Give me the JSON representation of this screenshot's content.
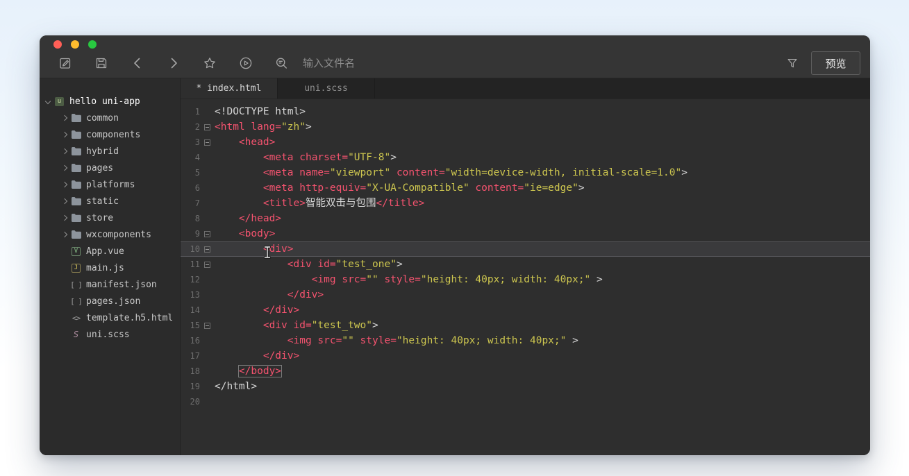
{
  "window": {
    "controls": [
      {
        "name": "close",
        "color": "#ff5f57"
      },
      {
        "name": "minimize",
        "color": "#febc2e"
      },
      {
        "name": "zoom",
        "color": "#28c840"
      }
    ]
  },
  "toolbar": {
    "icons": [
      "new-file",
      "save",
      "back",
      "forward",
      "star",
      "run",
      "find-file"
    ],
    "search": {
      "placeholder": "输入文件名",
      "value": ""
    },
    "right_icons": [
      "filter"
    ],
    "preview_label": "预览"
  },
  "sidebar": {
    "root": "hello uni-app",
    "folders": [
      "common",
      "components",
      "hybrid",
      "pages",
      "platforms",
      "static",
      "store",
      "wxcomponents"
    ],
    "files": [
      {
        "name": "App.vue",
        "icon": "vue-file"
      },
      {
        "name": "main.js",
        "icon": "js-file"
      },
      {
        "name": "manifest.json",
        "icon": "json-file"
      },
      {
        "name": "pages.json",
        "icon": "json-file"
      },
      {
        "name": "template.h5.html",
        "icon": "html-file"
      },
      {
        "name": "uni.scss",
        "icon": "scss-file"
      }
    ]
  },
  "tabs": [
    {
      "label": "* index.html",
      "active": true,
      "modified": true
    },
    {
      "label": "uni.scss",
      "active": false,
      "modified": false
    }
  ],
  "editor": {
    "language": "html",
    "current_line": 10,
    "lines": [
      {
        "n": 1,
        "fold": false,
        "toks": [
          [
            "p",
            "<!DOCTYPE html>"
          ]
        ]
      },
      {
        "n": 2,
        "fold": true,
        "toks": [
          [
            "t",
            "<html"
          ],
          [
            "p",
            " "
          ],
          [
            "t",
            "lang="
          ],
          [
            "s",
            "\"zh\""
          ],
          [
            "p",
            ">"
          ]
        ]
      },
      {
        "n": 3,
        "fold": true,
        "toks": [
          [
            "p",
            "    "
          ],
          [
            "t",
            "<head>"
          ]
        ]
      },
      {
        "n": 4,
        "fold": false,
        "toks": [
          [
            "p",
            "        "
          ],
          [
            "t",
            "<meta"
          ],
          [
            "p",
            " "
          ],
          [
            "t",
            "charset="
          ],
          [
            "s",
            "\"UTF-8\""
          ],
          [
            "p",
            ">"
          ]
        ]
      },
      {
        "n": 5,
        "fold": false,
        "toks": [
          [
            "p",
            "        "
          ],
          [
            "t",
            "<meta"
          ],
          [
            "p",
            " "
          ],
          [
            "t",
            "name="
          ],
          [
            "s",
            "\"viewport\""
          ],
          [
            "p",
            " "
          ],
          [
            "t",
            "content="
          ],
          [
            "s",
            "\"width=device-width, initial-scale=1.0\""
          ],
          [
            "p",
            ">"
          ]
        ]
      },
      {
        "n": 6,
        "fold": false,
        "toks": [
          [
            "p",
            "        "
          ],
          [
            "t",
            "<meta"
          ],
          [
            "p",
            " "
          ],
          [
            "t",
            "http-equiv="
          ],
          [
            "s",
            "\"X-UA-Compatible\""
          ],
          [
            "p",
            " "
          ],
          [
            "t",
            "content="
          ],
          [
            "s",
            "\"ie=edge\""
          ],
          [
            "p",
            ">"
          ]
        ]
      },
      {
        "n": 7,
        "fold": false,
        "toks": [
          [
            "p",
            "        "
          ],
          [
            "t",
            "<title>"
          ],
          [
            "p",
            "智能双击与包围"
          ],
          [
            "t",
            "</title>"
          ]
        ]
      },
      {
        "n": 8,
        "fold": false,
        "toks": [
          [
            "p",
            "    "
          ],
          [
            "t",
            "</head>"
          ]
        ]
      },
      {
        "n": 9,
        "fold": true,
        "toks": [
          [
            "p",
            "    "
          ],
          [
            "t",
            "<body>"
          ]
        ]
      },
      {
        "n": 10,
        "fold": true,
        "toks": [
          [
            "p",
            "        "
          ],
          [
            "t",
            "<div>"
          ]
        ]
      },
      {
        "n": 11,
        "fold": true,
        "toks": [
          [
            "p",
            "            "
          ],
          [
            "t",
            "<div"
          ],
          [
            "p",
            " "
          ],
          [
            "t",
            "id="
          ],
          [
            "s",
            "\"test_one\""
          ],
          [
            "p",
            ">"
          ]
        ]
      },
      {
        "n": 12,
        "fold": false,
        "toks": [
          [
            "p",
            "                "
          ],
          [
            "t",
            "<img"
          ],
          [
            "p",
            " "
          ],
          [
            "t",
            "src="
          ],
          [
            "s",
            "\"\""
          ],
          [
            "p",
            " "
          ],
          [
            "t",
            "style="
          ],
          [
            "s",
            "\"height: 40px; width: 40px;\""
          ],
          [
            "p",
            " >"
          ]
        ]
      },
      {
        "n": 13,
        "fold": false,
        "toks": [
          [
            "p",
            "            "
          ],
          [
            "t",
            "</div>"
          ]
        ]
      },
      {
        "n": 14,
        "fold": false,
        "toks": [
          [
            "p",
            "        "
          ],
          [
            "t",
            "</div>"
          ]
        ]
      },
      {
        "n": 15,
        "fold": true,
        "toks": [
          [
            "p",
            "        "
          ],
          [
            "t",
            "<div"
          ],
          [
            "p",
            " "
          ],
          [
            "t",
            "id="
          ],
          [
            "s",
            "\"test_two\""
          ],
          [
            "p",
            ">"
          ]
        ]
      },
      {
        "n": 16,
        "fold": false,
        "toks": [
          [
            "p",
            "            "
          ],
          [
            "t",
            "<img"
          ],
          [
            "p",
            " "
          ],
          [
            "t",
            "src="
          ],
          [
            "s",
            "\"\""
          ],
          [
            "p",
            " "
          ],
          [
            "t",
            "style="
          ],
          [
            "s",
            "\"height: 40px; width: 40px;\""
          ],
          [
            "p",
            " >"
          ]
        ]
      },
      {
        "n": 17,
        "fold": false,
        "toks": [
          [
            "p",
            "        "
          ],
          [
            "t",
            "</div>"
          ]
        ]
      },
      {
        "n": 18,
        "fold": false,
        "toks": [
          [
            "p",
            "    "
          ],
          [
            "t",
            "</body>",
            "m"
          ]
        ]
      },
      {
        "n": 19,
        "fold": false,
        "toks": [
          [
            "p",
            "</html>"
          ]
        ]
      },
      {
        "n": 20,
        "fold": false,
        "toks": []
      }
    ]
  },
  "colors": {
    "tag": "#f5536f",
    "string": "#cdc64f",
    "plain": "#d8d8d8",
    "editor_bg": "#2e2e2e",
    "traffic_red": "#ff5f57",
    "traffic_yellow": "#febc2e",
    "traffic_green": "#28c840"
  }
}
